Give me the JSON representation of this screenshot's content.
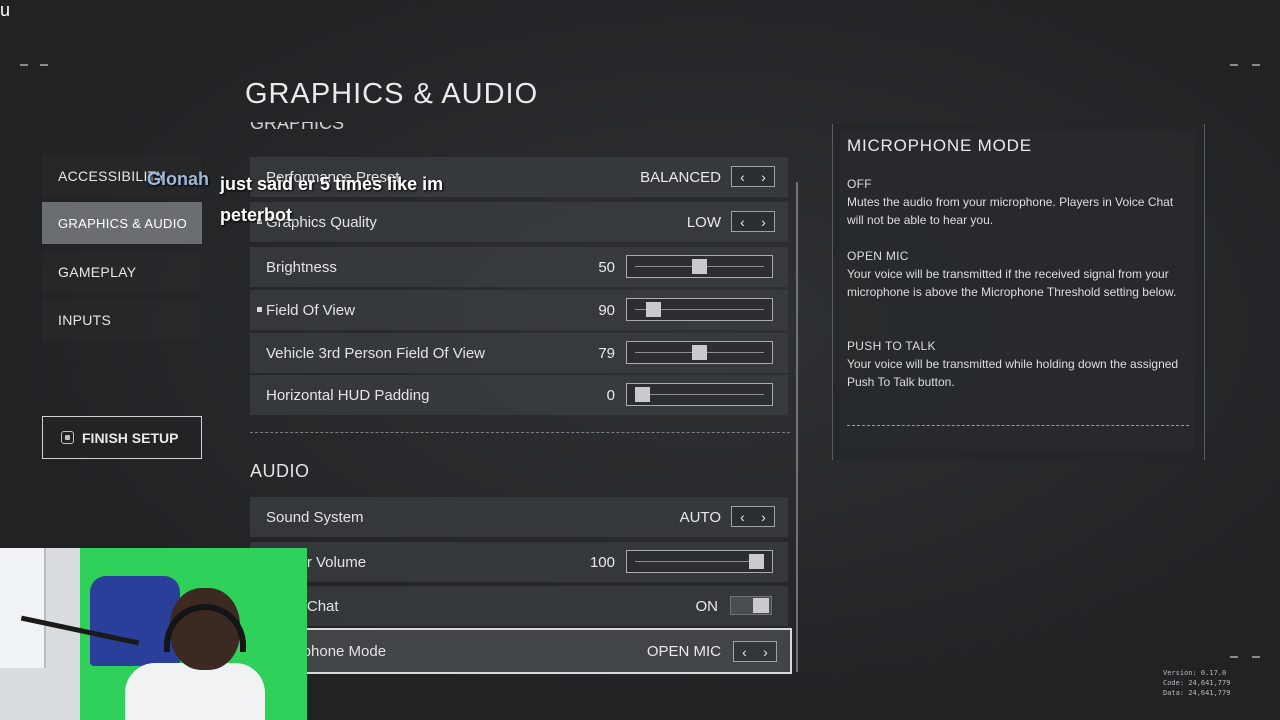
{
  "overlay": {
    "top_letter": "u",
    "chat_user": "Glonah",
    "chat_message": "just said   er 5 times like im peterbot"
  },
  "header": {
    "title": "GRAPHICS & AUDIO"
  },
  "nav": {
    "items": [
      {
        "label": "ACCESSIBILITY",
        "active": false
      },
      {
        "label": "GRAPHICS & AUDIO",
        "active": true
      },
      {
        "label": "GAMEPLAY",
        "active": false
      },
      {
        "label": "INPUTS",
        "active": false
      }
    ],
    "finish_label": "FINISH SETUP"
  },
  "graphics": {
    "section_label": "GRAPHICS",
    "rows": [
      {
        "label": "Performance Preset",
        "value": "BALANCED",
        "control": "arrows"
      },
      {
        "label": "Graphics Quality",
        "value": "LOW",
        "control": "arrows",
        "marked": true
      },
      {
        "label": "Brightness",
        "value": "50",
        "control": "slider",
        "fraction": 0.5
      },
      {
        "label": "Field Of View",
        "value": "90",
        "control": "slider",
        "fraction": 0.1,
        "marked": true
      },
      {
        "label": "Vehicle 3rd Person Field Of View",
        "value": "79",
        "control": "slider",
        "fraction": 0.5
      },
      {
        "label": "Horizontal HUD Padding",
        "value": "0",
        "control": "slider",
        "fraction": 0.0
      }
    ]
  },
  "audio": {
    "section_label": "AUDIO",
    "rows": [
      {
        "label": "Sound System",
        "value": "AUTO",
        "control": "arrows"
      },
      {
        "label": "Master Volume",
        "value": "100",
        "control": "slider",
        "fraction": 1.0
      },
      {
        "label": "Voice Chat",
        "value": "ON",
        "control": "toggle"
      },
      {
        "label": "Microphone Mode",
        "value": "OPEN MIC",
        "control": "arrows",
        "selected": true
      }
    ]
  },
  "info_panel": {
    "title": "MICROPHONE MODE",
    "entries": [
      {
        "head": "OFF",
        "body": "Mutes the audio from your microphone. Players in Voice Chat will not be able to hear you."
      },
      {
        "head": "OPEN MIC",
        "body": "Your voice will be transmitted if the received signal from your microphone is above the Microphone Threshold setting below."
      },
      {
        "head": "PUSH TO TALK",
        "body": "Your voice will be transmitted while holding down the assigned Push To Talk button."
      }
    ]
  },
  "version": {
    "version": "Version: 0.17.0",
    "code": "Code: 24,641,779",
    "data": "Data: 24,641,779"
  }
}
